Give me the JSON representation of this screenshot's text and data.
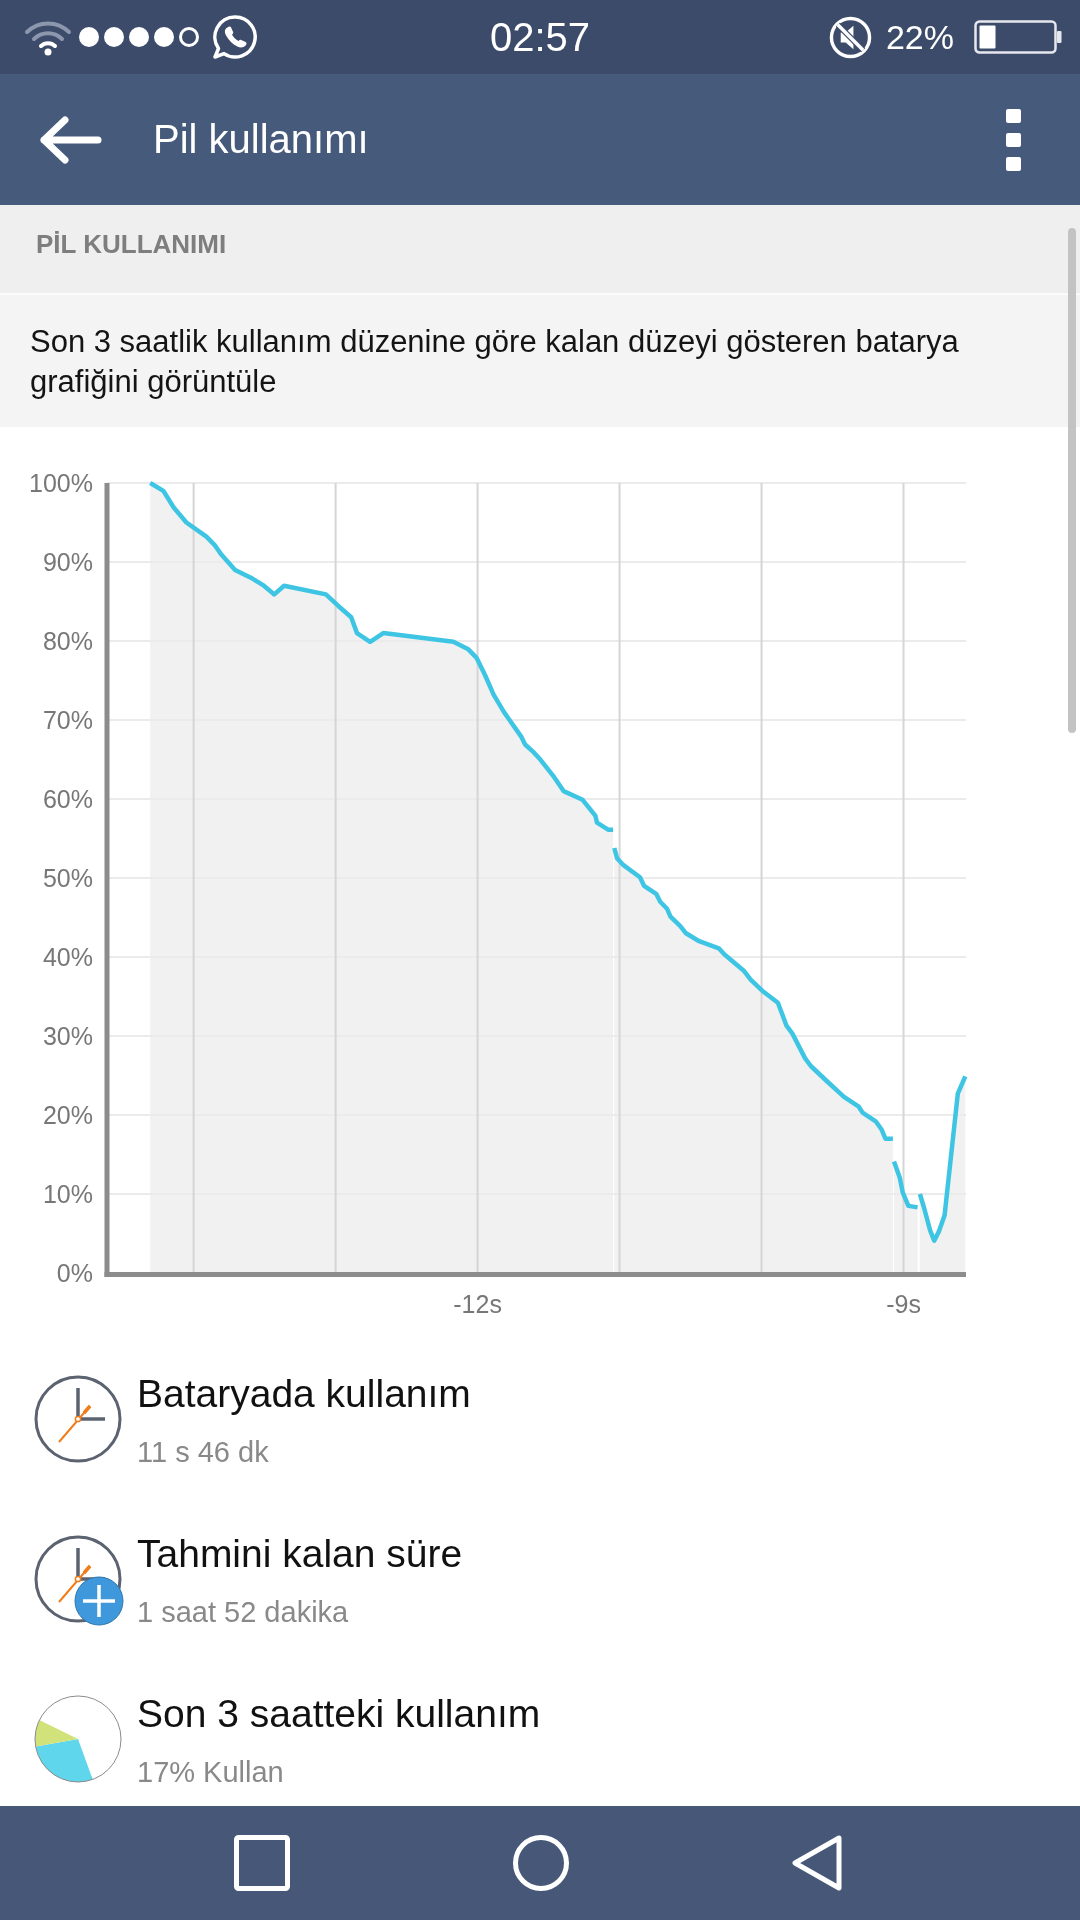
{
  "status_bar": {
    "time": "02:57",
    "battery_percent": "22%"
  },
  "app_bar": {
    "title": "Pil kullanımı"
  },
  "battery_section": {
    "header": "PİL KULLANIMI",
    "description": "Son 3 saatlik kullanım düzenine göre kalan düzeyi gösteren batarya grafiğini görüntüle"
  },
  "chart": {
    "chart_data": {
      "type": "area",
      "grid": true,
      "x": [
        -14.306,
        -14.213,
        -14.14,
        -14.051,
        -13.91,
        -13.849,
        -13.808,
        -13.708,
        -13.586,
        -13.505,
        -13.432,
        -13.363,
        -13.068,
        -12.979,
        -12.89,
        -12.849,
        -12.757,
        -12.664,
        -12.17,
        -12.069,
        -12.008,
        -11.948,
        -11.887,
        -11.814,
        -11.693,
        -11.665,
        -11.604,
        -11.563,
        -11.462,
        -11.394,
        -11.26,
        -11.171,
        -11.159,
        -11.078,
        -11.046,
        -11.042,
        -11.037,
        -11.017,
        -10.977,
        -10.856,
        -10.827,
        -10.742,
        -10.714,
        -10.665,
        -10.641,
        -10.572,
        -10.532,
        -10.439,
        -10.301,
        -10.261,
        -10.127,
        -10.075,
        -9.986,
        -9.885,
        -9.824,
        -9.783,
        -9.694,
        -9.653,
        -9.541,
        -9.419,
        -9.318,
        -9.289,
        -9.196,
        -9.156,
        -9.128,
        -9.075,
        -9.071,
        -9.067,
        -9.027,
        -9.006,
        -8.966,
        -8.901,
        -8.893,
        -8.885,
        -8.853,
        -8.813,
        -8.784,
        -8.752,
        -8.711,
        -8.618,
        -8.565
      ],
      "series": [
        {
          "color": "#3ec5e3",
          "values": [
            100,
            99,
            96.9,
            95,
            93.2,
            92.1,
            91,
            89,
            87.9,
            87,
            85.9,
            87,
            85.9,
            84.4,
            83,
            81,
            79.9,
            81,
            79.9,
            79,
            77.9,
            75.7,
            73.2,
            71,
            67.9,
            66.9,
            65.9,
            65.1,
            62.8,
            61,
            59.9,
            57.9,
            57,
            56.1,
            56.1,
            null,
            53.8,
            52.5,
            51.7,
            50.1,
            49,
            48,
            47,
            46.1,
            45.1,
            43.9,
            43,
            42,
            41.1,
            40.3,
            38.3,
            37.1,
            35.6,
            34.2,
            31.3,
            30.3,
            27.2,
            26.2,
            24.3,
            22.3,
            21.1,
            20.3,
            19.2,
            18.2,
            17,
            17,
            null,
            14.1,
            12.1,
            10.2,
            8.5,
            8.3,
            null,
            10,
            8.1,
            5.4,
            4.1,
            5.2,
            7.3,
            22.7,
            24.9
          ]
        }
      ],
      "xlim": [
        -14.61,
        -8.56
      ],
      "ylim": [
        0,
        100
      ],
      "xticks": [
        {
          "value": -12,
          "label": "-12s"
        },
        {
          "value": -9,
          "label": "-9s"
        }
      ],
      "yticks": [
        {
          "value": 0,
          "label": "0%"
        },
        {
          "value": 10,
          "label": "10%"
        },
        {
          "value": 20,
          "label": "20%"
        },
        {
          "value": 30,
          "label": "30%"
        },
        {
          "value": 40,
          "label": "40%"
        },
        {
          "value": 50,
          "label": "50%"
        },
        {
          "value": 60,
          "label": "60%"
        },
        {
          "value": 70,
          "label": "70%"
        },
        {
          "value": 80,
          "label": "80%"
        },
        {
          "value": 90,
          "label": "90%"
        },
        {
          "value": 100,
          "label": "100%"
        }
      ]
    }
  },
  "stats": [
    {
      "kind": "clock",
      "title": "Bataryada kullanım",
      "value": "11 s 46 dk"
    },
    {
      "kind": "clock_plus",
      "title": "Tahmini kalan süre",
      "value": "1 saat 52 dakika"
    },
    {
      "kind": "pie",
      "title": "Son 3 saatteki kullanım",
      "value": "17% Kullan"
    }
  ]
}
